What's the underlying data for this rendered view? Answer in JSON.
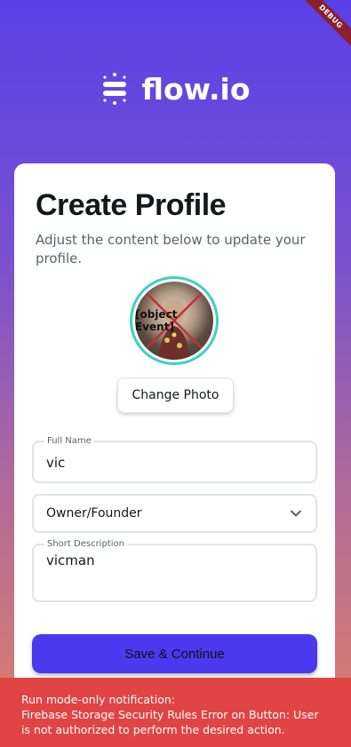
{
  "debug_banner": "DEBUG",
  "logo": {
    "text": "flow.io",
    "icon": "flow-logo-icon"
  },
  "card": {
    "title": "Create Profile",
    "subtitle": "Adjust the content below to update your profile.",
    "avatar": {
      "overlay_text": "[object Event]"
    },
    "change_photo_label": "Change Photo",
    "full_name": {
      "label": "Full Name",
      "value": "vic"
    },
    "role": {
      "value": "Owner/Founder",
      "icon": "chevron-down-icon"
    },
    "short_description": {
      "label": "Short Description",
      "value": "vicman"
    },
    "save_label": "Save & Continue"
  },
  "notification": {
    "line1": "Run mode-only notification:",
    "line2": "Firebase Storage Security Rules Error on Button: User is not authorized to perform the desired action."
  },
  "colors": {
    "accent": "#4b39ef",
    "avatar_border": "#39d2c0",
    "error_bar": "#e04444"
  }
}
